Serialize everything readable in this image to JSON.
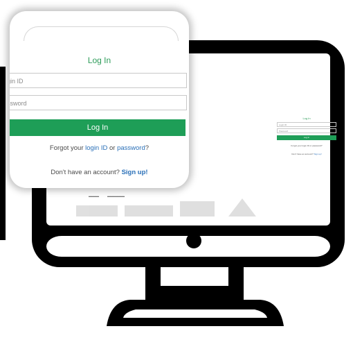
{
  "login_card": {
    "title": "Log In",
    "login_id_placeholder": "gin ID",
    "password_placeholder": "ssword",
    "login_button": "Log In",
    "forgot_prefix": "Forgot your",
    "forgot_login_link": "login ID",
    "forgot_or": "or",
    "forgot_password_link": "password",
    "forgot_suffix": "?",
    "signup_prefix": "Don't have an account?",
    "signup_link": "Sign up!"
  },
  "screen": {
    "mini_title": "Log In",
    "mini_login_id": "Login ID",
    "mini_password": "Password",
    "mini_button": "Log In",
    "mini_forgot": "Forgot your login ID or password?",
    "mini_signup_prefix": "Don't have an account?",
    "mini_signup_link": "Sign up!"
  },
  "colors": {
    "brand_green": "#1e9e57",
    "link_blue": "#2a70b8",
    "monitor_frame": "#000000"
  }
}
